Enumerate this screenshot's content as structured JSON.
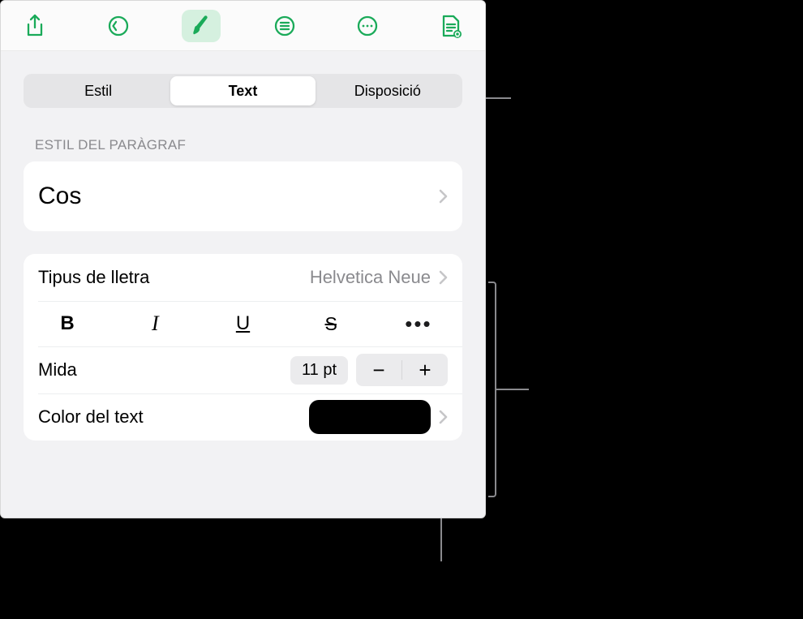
{
  "segmentedTabs": {
    "style": "Estil",
    "text": "Text",
    "layout": "Disposició"
  },
  "paragraphStyle": {
    "header": "Estil del paràgraf",
    "value": "Cos"
  },
  "font": {
    "label": "Tipus de lletra",
    "value": "Helvetica Neue",
    "bold": "B",
    "italic": "I",
    "underline": "U",
    "strike": "S",
    "more": "•••"
  },
  "size": {
    "label": "Mida",
    "value": "11 pt",
    "minus": "−",
    "plus": "+"
  },
  "textColor": {
    "label": "Color del text",
    "swatch": "#000000"
  }
}
